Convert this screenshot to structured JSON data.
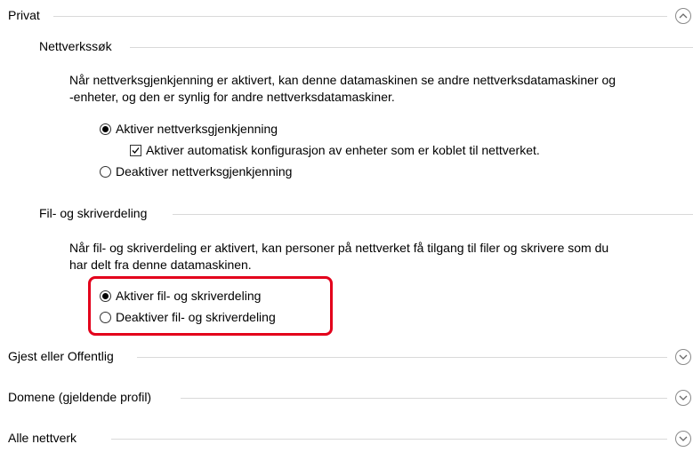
{
  "sections": {
    "privat": {
      "title": "Privat",
      "expand_icon": "chevron-up-icon"
    },
    "nettverkssok": {
      "title": "Nettverkssøk",
      "desc_line1": "Når nettverksgjenkjenning er aktivert, kan denne datamaskinen se andre nettverksdatamaskiner og",
      "desc_line2": "-enheter, og den er synlig for andre nettverksdatamaskiner.",
      "enable_label": "Aktiver nettverksgjenkjenning",
      "enable_selected": true,
      "auto_config_label": "Aktiver automatisk konfigurasjon av enheter som er koblet til nettverket.",
      "auto_config_checked": true,
      "disable_label": "Deaktiver nettverksgjenkjenning"
    },
    "fildeling": {
      "title": "Fil- og skriverdeling",
      "desc_line1": "Når fil- og skriverdeling er aktivert, kan personer på nettverket få tilgang til filer og skrivere som du",
      "desc_line2": "har delt fra denne datamaskinen.",
      "enable_label": "Aktiver fil- og skriverdeling",
      "enable_selected": true,
      "disable_label": "Deaktiver fil- og skriverdeling",
      "highlight_color": "#e3001b"
    },
    "gjest": {
      "title": "Gjest eller Offentlig",
      "expand_icon": "chevron-down-icon"
    },
    "domene": {
      "title": "Domene (gjeldende profil)",
      "expand_icon": "chevron-down-icon"
    },
    "alle": {
      "title": "Alle nettverk",
      "expand_icon": "chevron-down-icon"
    }
  }
}
